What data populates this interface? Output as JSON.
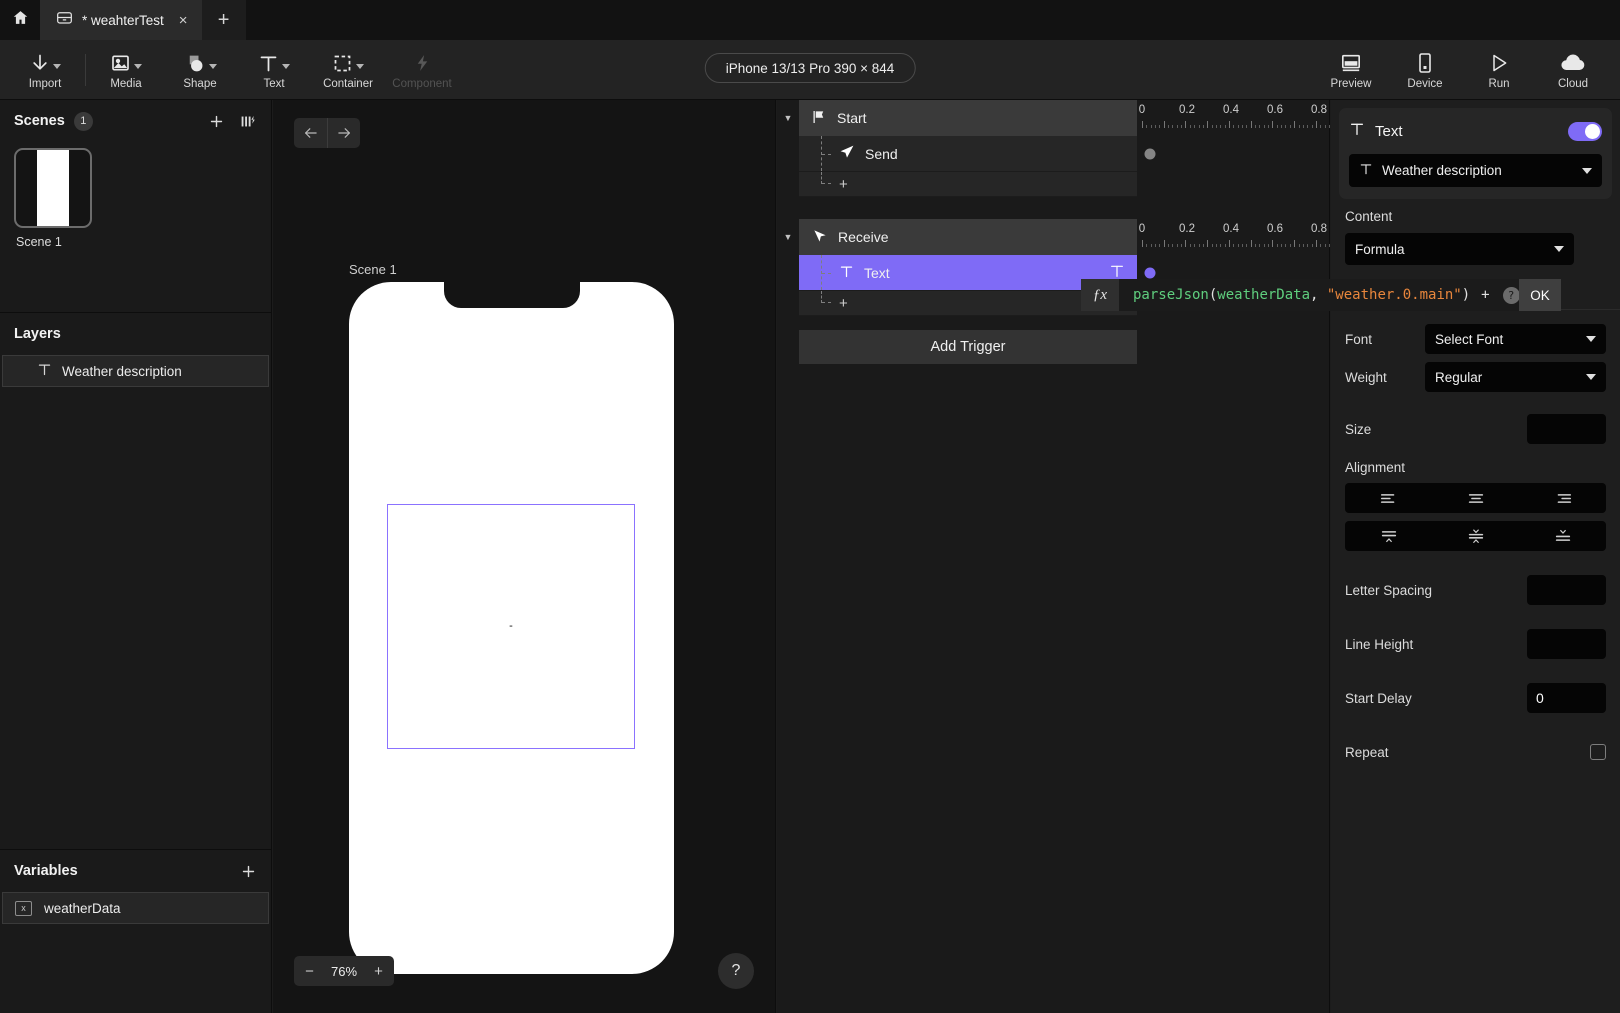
{
  "window": {
    "home_icon": "home-icon",
    "tab": {
      "icon": "file-archive-icon",
      "title": "* weahterTest",
      "close": "×"
    },
    "new_tab": "+"
  },
  "toolbar": {
    "items": [
      {
        "label": "Import",
        "icon": "download-arrow-icon",
        "has_caret": true,
        "disabled": false
      },
      {
        "label": "Media",
        "icon": "image-icon",
        "has_caret": true,
        "disabled": false
      },
      {
        "label": "Shape",
        "icon": "shapes-icon",
        "has_caret": true,
        "disabled": false
      },
      {
        "label": "Text",
        "icon": "text-t-icon",
        "has_caret": true,
        "disabled": false
      },
      {
        "label": "Container",
        "icon": "dashed-square-icon",
        "has_caret": true,
        "disabled": false
      },
      {
        "label": "Component",
        "icon": "lightning-bolt-icon",
        "has_caret": false,
        "disabled": true
      }
    ],
    "device_pill": "iPhone 13/13 Pro  390 × 844",
    "right_items": [
      {
        "label": "Preview",
        "icon": "monitor-icon"
      },
      {
        "label": "Device",
        "icon": "phone-icon"
      },
      {
        "label": "Run",
        "icon": "play-triangle-icon"
      },
      {
        "label": "Cloud",
        "icon": "cloud-icon"
      }
    ]
  },
  "sidebar": {
    "scenes": {
      "title": "Scenes",
      "count": "1",
      "add_icon": "plus-icon",
      "layout_icon": "columns-lightning-icon",
      "items": [
        {
          "name": "Scene 1"
        }
      ]
    },
    "layers": {
      "title": "Layers",
      "items": [
        {
          "icon": "text-t-icon",
          "label": "Weather description"
        }
      ]
    },
    "variables": {
      "title": "Variables",
      "add_icon": "plus-icon",
      "items": [
        {
          "chip": "x",
          "label": "weatherData"
        }
      ]
    }
  },
  "canvas": {
    "back_icon": "arrow-left-icon",
    "forward_icon": "arrow-right-icon",
    "scene_label": "Scene 1",
    "selected_text_value": "-",
    "zoom": {
      "minus": "−",
      "value": "76%",
      "plus": "+"
    },
    "help": "?"
  },
  "timeline": {
    "groups": [
      {
        "name": "Start",
        "icon": "flag-icon",
        "disclosure": "▼",
        "ruler": {
          "labels": [
            "0",
            "0.2",
            "0.4",
            "0.6",
            "0.8"
          ]
        },
        "rows": [
          {
            "label": "Send",
            "icon": "send-paperplane-icon",
            "selected": false,
            "keyframe": "gray"
          }
        ],
        "add_row": "+"
      },
      {
        "name": "Receive",
        "icon": "receive-paperplane-icon",
        "disclosure": "▼",
        "ruler": {
          "labels": [
            "0",
            "0.2",
            "0.4",
            "0.6",
            "0.8"
          ]
        },
        "rows": [
          {
            "label": "Text",
            "icon": "text-t-icon",
            "trailing_icon": "text-t-icon",
            "selected": true,
            "keyframe": "purple"
          }
        ],
        "add_row": "+"
      }
    ],
    "add_trigger": "Add Trigger"
  },
  "formula": {
    "fx_label": "ƒx",
    "tokens": [
      {
        "t": "parseJson",
        "c": "fn"
      },
      {
        "t": "(",
        "c": "punc"
      },
      {
        "t": "weatherData",
        "c": "var"
      },
      {
        "t": ", ",
        "c": "punc"
      },
      {
        "t": "\"weather.0.main\"",
        "c": "str"
      },
      {
        "t": ")",
        "c": "punc"
      }
    ],
    "plus": "+",
    "help": "?",
    "ok": "OK"
  },
  "inspector": {
    "header": {
      "icon": "text-t-icon",
      "title": "Text",
      "toggle_on": true
    },
    "layer_select": {
      "icon": "text-t-icon",
      "value": "Weather description"
    },
    "content": {
      "label": "Content",
      "value": "Formula"
    },
    "font": {
      "label": "Font",
      "value": "Select Font"
    },
    "weight": {
      "label": "Weight",
      "value": "Regular"
    },
    "size": {
      "label": "Size",
      "value": ""
    },
    "alignment": {
      "label": "Alignment",
      "horizontal": [
        "align-left-icon",
        "align-center-icon",
        "align-right-icon"
      ],
      "vertical": [
        "align-top-icon",
        "align-middle-icon",
        "align-bottom-icon"
      ]
    },
    "letter_spacing": {
      "label": "Letter Spacing",
      "value": ""
    },
    "line_height": {
      "label": "Line Height",
      "value": ""
    },
    "start_delay": {
      "label": "Start Delay",
      "value": "0"
    },
    "repeat": {
      "label": "Repeat",
      "checked": false
    }
  },
  "colors": {
    "accent": "#7f6bf6",
    "bg": "#1a1a1a",
    "panel": "#1e1e1e",
    "string": "#e8863c",
    "function": "#5fce7e"
  }
}
